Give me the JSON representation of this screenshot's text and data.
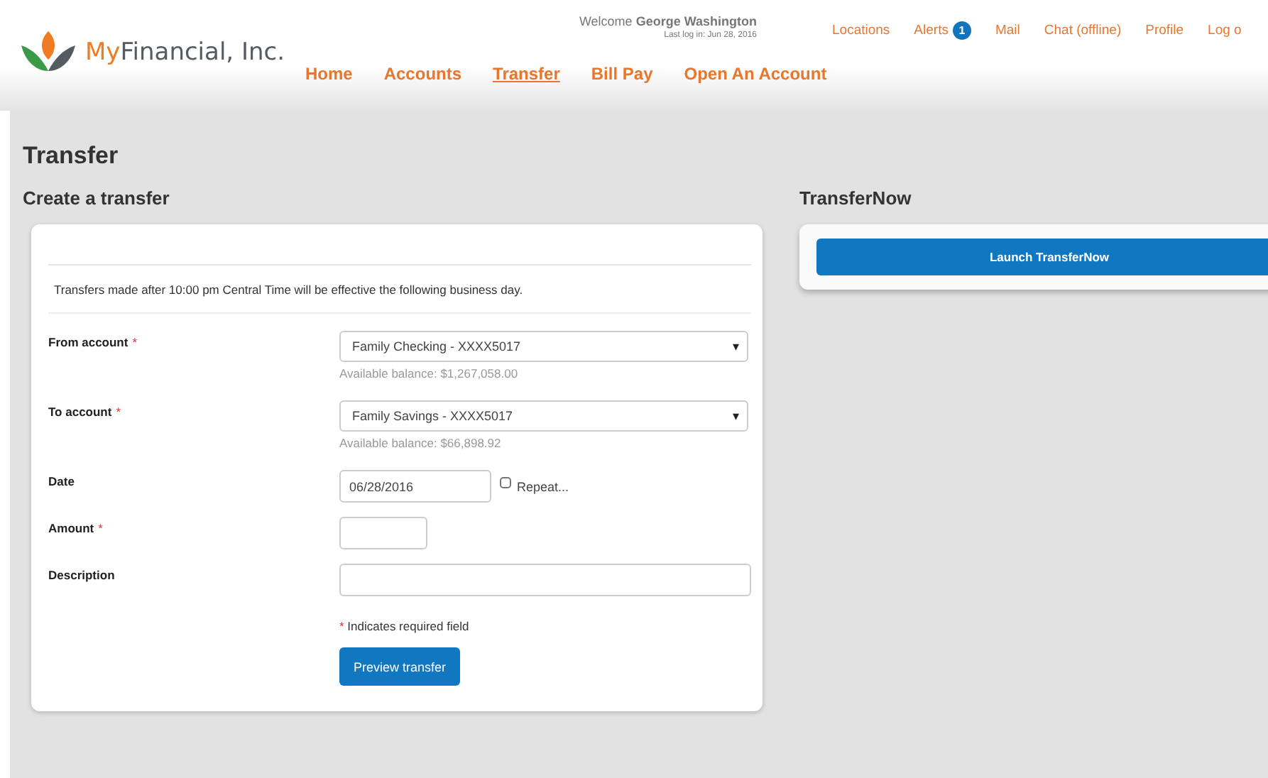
{
  "brand": {
    "accent": "My",
    "rest": "Financial, Inc."
  },
  "welcome": {
    "greeting": "Welcome",
    "name": "George Washington",
    "last_login": "Last log in: Jun 28, 2016"
  },
  "top_links": [
    {
      "label": "Locations"
    },
    {
      "label": "Alerts",
      "badge": "1"
    },
    {
      "label": "Mail"
    },
    {
      "label": "Chat (offline)"
    },
    {
      "label": "Profile"
    },
    {
      "label": "Log o"
    }
  ],
  "nav": [
    {
      "label": "Home",
      "selected": false
    },
    {
      "label": "Accounts",
      "selected": false
    },
    {
      "label": "Transfer",
      "selected": true
    },
    {
      "label": "Bill Pay",
      "selected": false
    },
    {
      "label": "Open An Account",
      "selected": false
    }
  ],
  "page_title": "Transfer",
  "form": {
    "heading": "Create a transfer",
    "notice": "Transfers made after 10:00 pm Central Time will be effective the following business day.",
    "fields": [
      {
        "kind": "select",
        "label": "From account",
        "required": true,
        "value": "Family Checking - XXXX5017",
        "caret": "▾",
        "help": "Available balance: $1,267,058.00"
      },
      {
        "kind": "select",
        "label": "To account",
        "required": true,
        "value": "Family Savings - XXXX5017",
        "caret": "▾",
        "help": "Available balance: $66,898.92"
      },
      {
        "kind": "date",
        "label": "Date",
        "required": false,
        "value": "06/28/2016",
        "repeat": {
          "label": "Repeat...",
          "checked": false
        }
      },
      {
        "kind": "amount",
        "label": "Amount",
        "required": true
      },
      {
        "kind": "text",
        "label": "Description",
        "required": false
      }
    ],
    "required_note": {
      "mark": "*",
      "text": "Indicates required field"
    },
    "submit": "Preview transfer"
  },
  "side": {
    "heading": "TransferNow",
    "button": "Launch TransferNow"
  }
}
